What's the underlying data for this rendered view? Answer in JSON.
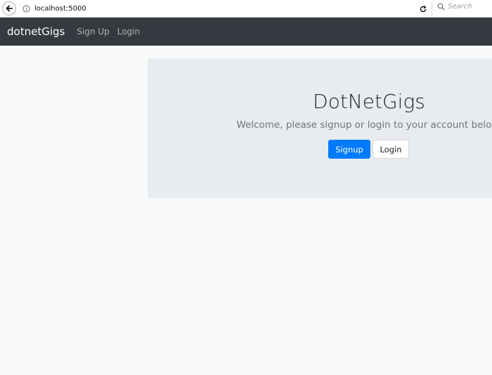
{
  "browser": {
    "url": "localhost:5000",
    "search_placeholder": "Search"
  },
  "navbar": {
    "brand": "dotnetGigs",
    "links": [
      {
        "label": "Sign Up"
      },
      {
        "label": "Login"
      }
    ]
  },
  "jumbotron": {
    "title": "DotNetGigs",
    "lead": "Welcome, please signup or login to your account below.",
    "signup_button": "Signup",
    "login_button": "Login"
  },
  "colors": {
    "navbar_bg": "#343a40",
    "primary": "#007bff",
    "jumbotron_bg": "#e9ecef",
    "page_bg": "#f8f9fa"
  }
}
